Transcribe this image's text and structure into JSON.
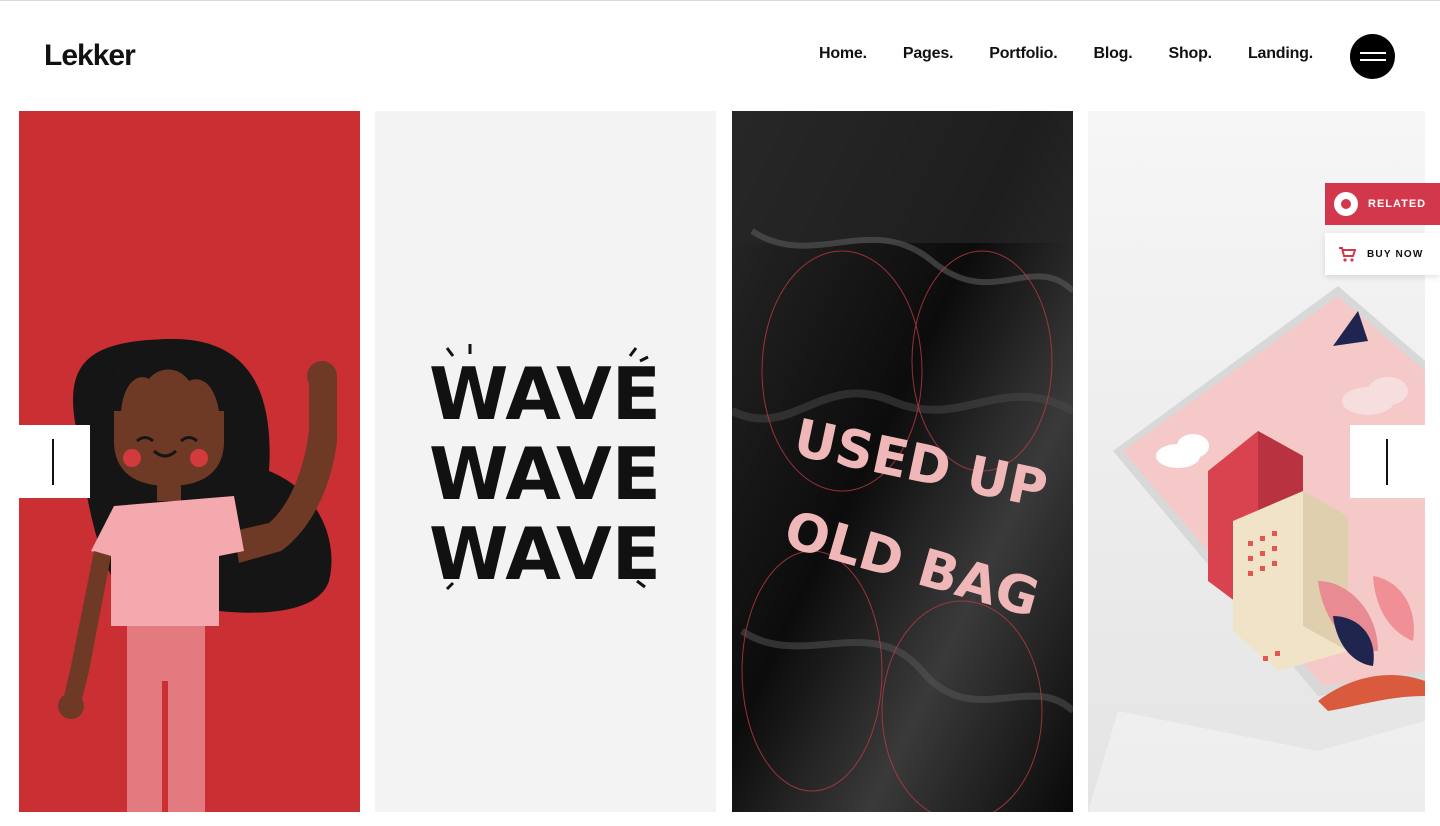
{
  "brand": {
    "logo_text": "Lekker"
  },
  "nav": {
    "items": [
      {
        "label": "Home."
      },
      {
        "label": "Pages."
      },
      {
        "label": "Portfolio."
      },
      {
        "label": "Blog."
      },
      {
        "label": "Shop."
      },
      {
        "label": "Landing."
      }
    ],
    "menu_icon": "hamburger-icon"
  },
  "slider": {
    "slides": [
      {
        "artwork": "girl-illustration",
        "background": "#c92f33"
      },
      {
        "artwork": "wave-typography",
        "background": "#f3f3f3",
        "lettering": [
          "WAVE",
          "WAVE",
          "WAVE"
        ]
      },
      {
        "artwork": "plastic-bag-poster",
        "background": "#141414",
        "lettering": [
          "USED UP",
          "OLD BAG"
        ]
      },
      {
        "artwork": "city-print-mockup",
        "background": "#eeeeee"
      }
    ],
    "prev_icon": "arrow-left-icon",
    "next_icon": "arrow-right-icon"
  },
  "side_buttons": {
    "related_label": "RELATED",
    "related_icon": "related-icon",
    "buy_label": "BUY NOW",
    "buy_icon": "cart-icon"
  },
  "colors": {
    "accent": "#d3374c",
    "black": "#000000"
  }
}
